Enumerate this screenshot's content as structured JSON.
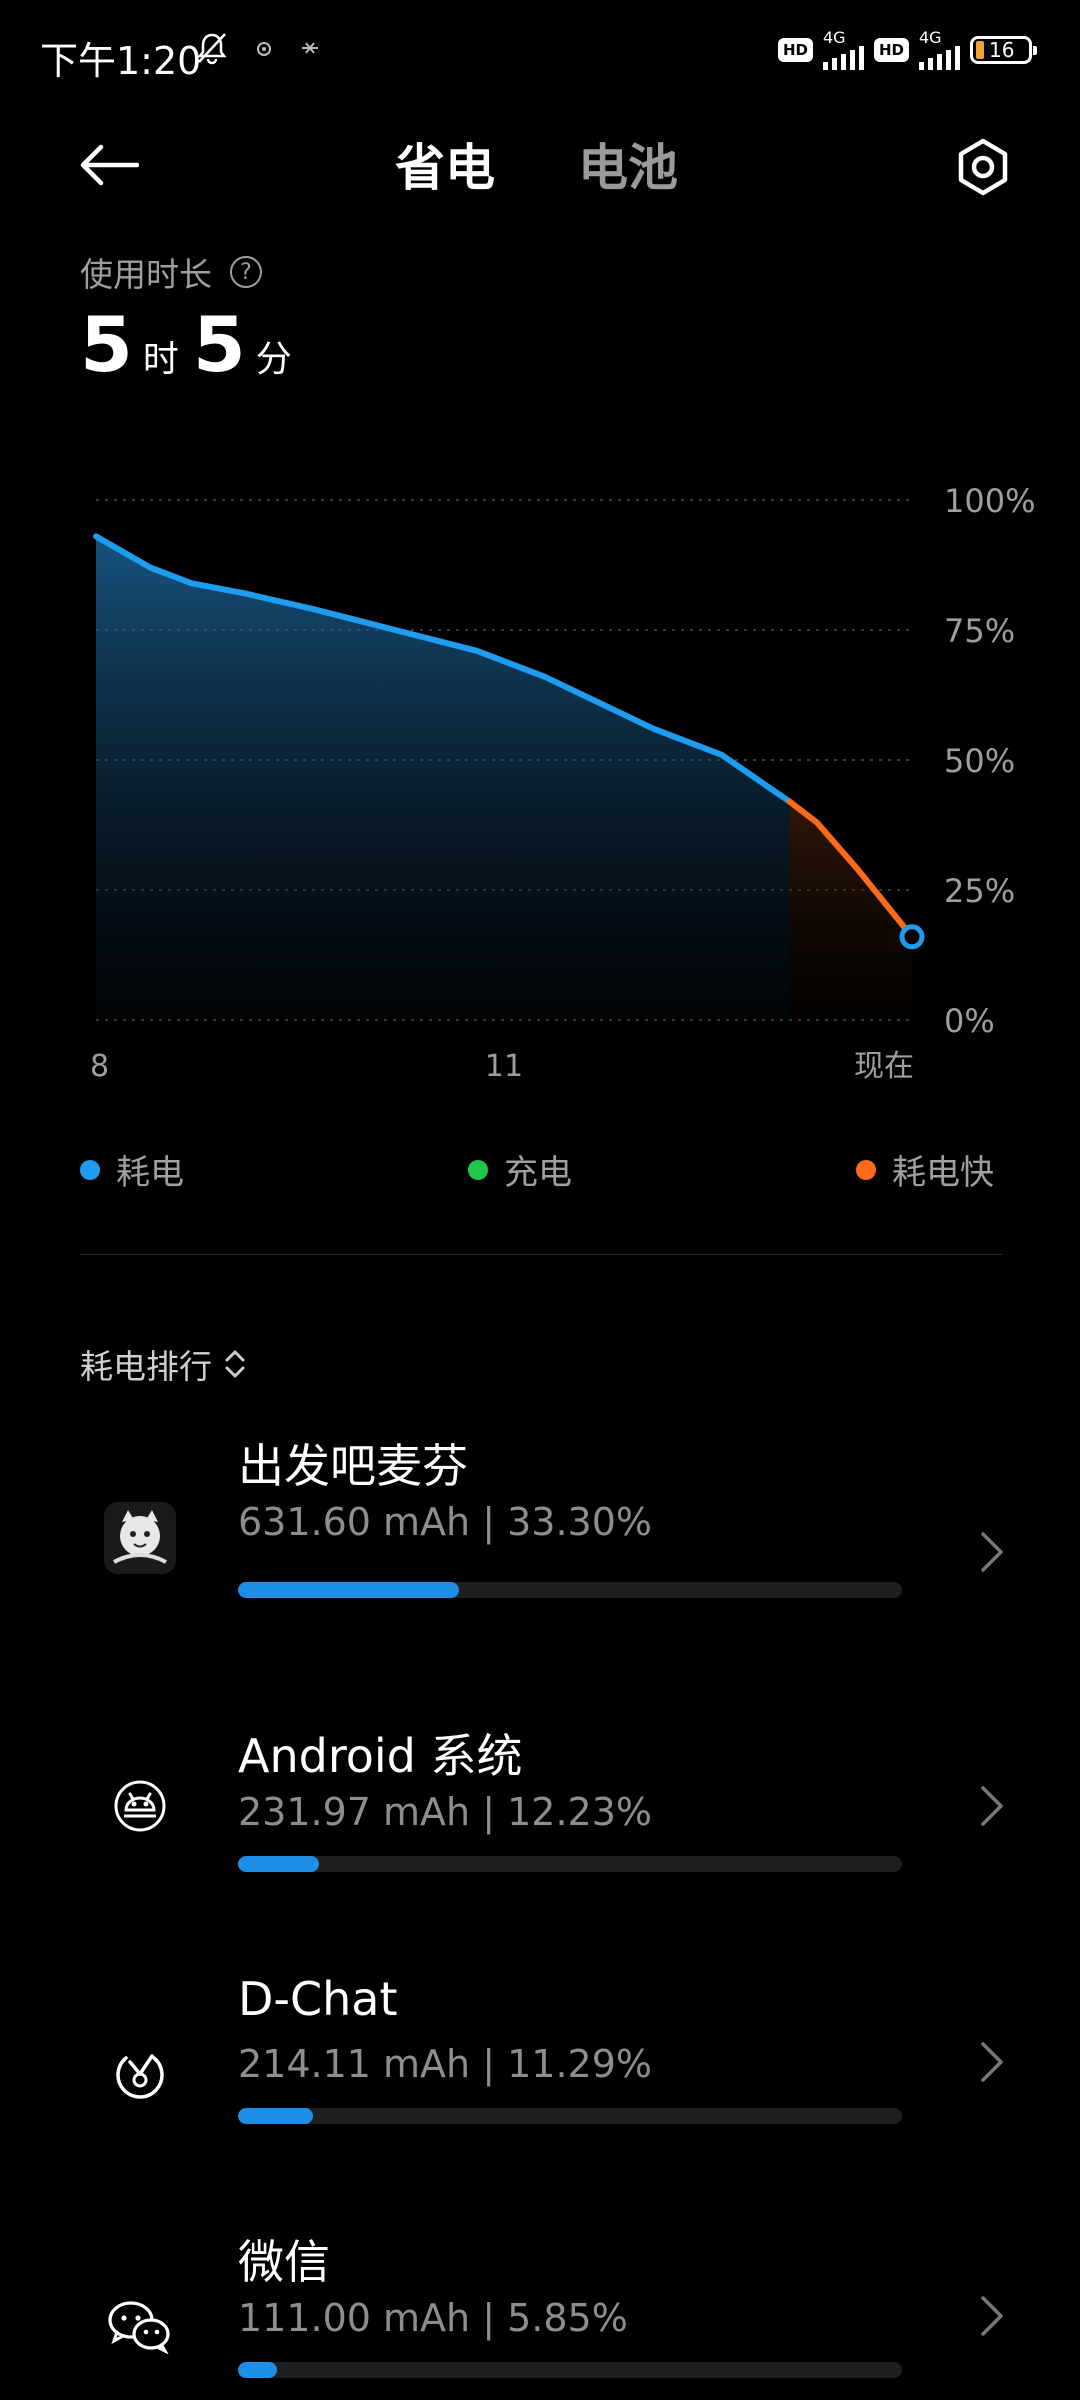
{
  "status_bar": {
    "time": "下午1:20",
    "hd_badge": "HD",
    "network": "4G",
    "battery_level": "16"
  },
  "header": {
    "tab_active": "省电",
    "tab_inactive": "电池"
  },
  "usage": {
    "label": "使用时长",
    "hours": "5",
    "hours_unit": "时",
    "minutes": "5",
    "minutes_unit": "分"
  },
  "chart_data": {
    "type": "area",
    "ylim": [
      0,
      100
    ],
    "y_ticks": [
      "100%",
      "75%",
      "50%",
      "25%",
      "0%"
    ],
    "x_ticks": [
      "8",
      "11",
      "现在"
    ],
    "colors": {
      "normal": "#1e9cf0",
      "fast": "#ff6a1a",
      "charging": "#21c74a"
    },
    "series": [
      {
        "name": "耗电",
        "x": [
          8.0,
          8.4,
          8.7,
          9.1,
          9.6,
          10.2,
          10.8,
          11.3,
          11.7,
          12.1,
          12.6,
          13.1
        ],
        "y": [
          93,
          87,
          84,
          82,
          79,
          75,
          71,
          66,
          61,
          56,
          51,
          42
        ]
      },
      {
        "name": "耗电快",
        "x": [
          13.1,
          13.3,
          13.6,
          14.0
        ],
        "y": [
          42,
          38,
          29,
          16
        ]
      }
    ]
  },
  "legend": [
    {
      "label": "耗电",
      "color": "#1e9cf0"
    },
    {
      "label": "充电",
      "color": "#21c74a"
    },
    {
      "label": "耗电快",
      "color": "#ff6a1a"
    }
  ],
  "ranking": {
    "title": "耗电排行",
    "apps": [
      {
        "name": "出发吧麦芬",
        "stats": "631.60 mAh | 33.30%",
        "percent": 33.3,
        "icon": "game-character-icon"
      },
      {
        "name": "Android 系统",
        "stats": "231.97 mAh | 12.23%",
        "percent": 12.23,
        "icon": "android-robot-icon"
      },
      {
        "name": "D-Chat",
        "stats": "214.11 mAh | 11.29%",
        "percent": 11.29,
        "icon": "dchat-icon"
      },
      {
        "name": "微信",
        "stats": "111.00 mAh | 5.85%",
        "percent": 5.85,
        "icon": "wechat-icon"
      }
    ]
  }
}
